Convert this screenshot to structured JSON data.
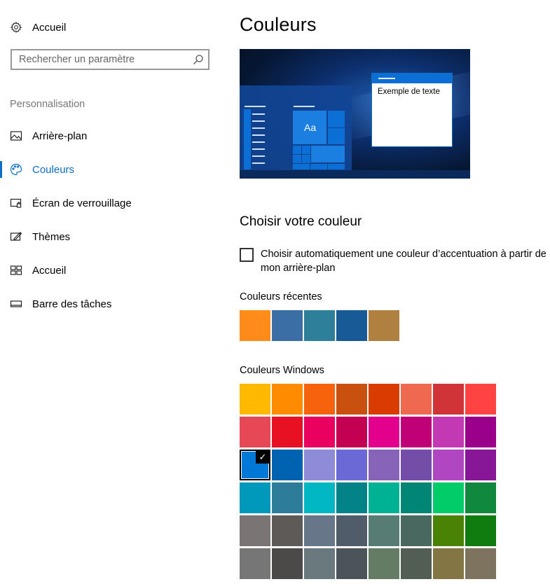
{
  "sidebar": {
    "home": {
      "label": "Accueil",
      "icon": "gear-icon"
    },
    "search": {
      "placeholder": "Rechercher un paramètre",
      "value": ""
    },
    "section": "Personnalisation",
    "items": [
      {
        "label": "Arrière-plan",
        "icon": "picture-icon",
        "active": false
      },
      {
        "label": "Couleurs",
        "icon": "palette-icon",
        "active": true
      },
      {
        "label": "Écran de verrouillage",
        "icon": "lock-screen-icon",
        "active": false
      },
      {
        "label": "Thèmes",
        "icon": "themes-icon",
        "active": false
      },
      {
        "label": "Accueil",
        "icon": "start-icon",
        "active": false
      },
      {
        "label": "Barre des tâches",
        "icon": "taskbar-icon",
        "active": false
      }
    ]
  },
  "main": {
    "title": "Couleurs",
    "preview": {
      "sample_text": "Exemple de texte",
      "tile_text": "Aa"
    },
    "choose_heading": "Choisir votre couleur",
    "auto_accent": {
      "label": "Choisir automatiquement une couleur d’accentuation à partir de mon arrière-plan",
      "checked": false
    },
    "recent_label": "Couleurs récentes",
    "recent_colors": [
      "#FF8C1A",
      "#3A6EA5",
      "#2E7F9A",
      "#185A96",
      "#B08040"
    ],
    "windows_label": "Couleurs Windows",
    "selected_color": "#0078D7",
    "windows_colors": [
      "#FFB900",
      "#FF8C00",
      "#F7630C",
      "#CA5010",
      "#DA3B01",
      "#EF6950",
      "#D13438",
      "#FF4343",
      "#E74856",
      "#E81123",
      "#EA005E",
      "#C30052",
      "#E3008C",
      "#BF0077",
      "#C239B3",
      "#9A0089",
      "#0078D7",
      "#0063B1",
      "#8E8CD8",
      "#6B69D6",
      "#8764B8",
      "#744DA9",
      "#B146C2",
      "#881798",
      "#0099BC",
      "#2D7D9A",
      "#00B7C3",
      "#038387",
      "#00B294",
      "#018574",
      "#00CC6A",
      "#10893E",
      "#7A7574",
      "#5D5A58",
      "#68768A",
      "#515C6B",
      "#567C73",
      "#486860",
      "#498205",
      "#107C10",
      "#767676",
      "#4C4A48",
      "#69797E",
      "#4A5459",
      "#647C64",
      "#525E54",
      "#847545",
      "#7E735F"
    ]
  }
}
